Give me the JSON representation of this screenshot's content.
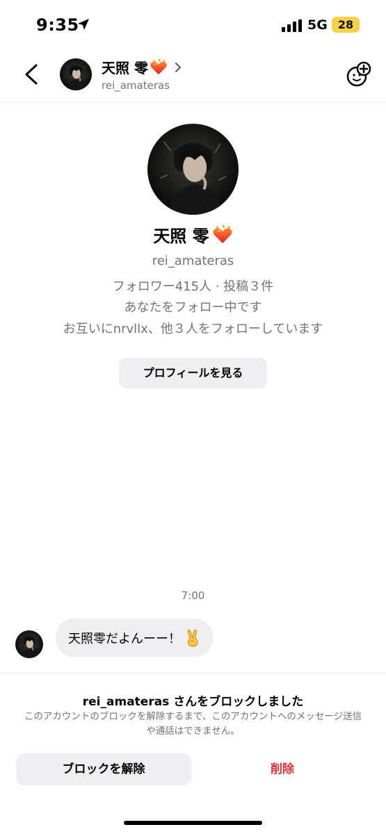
{
  "status_bar": {
    "time": "9:35",
    "network": "5G",
    "battery": "28",
    "battery_color": "#f6d24a"
  },
  "header": {
    "name": "天照 零",
    "username": "rei_amateras",
    "heart_icon": "heart-on-fire-icon",
    "effects_icon": "face-plus-icon"
  },
  "profile": {
    "name": "天照 零",
    "username": "rei_amateras",
    "stats": "フォロワー415人 · 投稿３件",
    "follow_status": "あなたをフォロー中です",
    "mutual": "お互いにnrvllx、他３人をフォローしています",
    "view_profile_label": "プロフィールを見る"
  },
  "messages": {
    "timestamp": "7:00",
    "items": [
      {
        "text": "天照零だよんーー！",
        "emoji_icon": "victory-hand-icon"
      }
    ]
  },
  "block_notice": {
    "title": "rei_amateras さんをブロックしました",
    "description": "このアカウントのブロックを解除するまで、このアカウントへのメッセージ送信や通話はできません。",
    "unblock_label": "ブロックを解除",
    "delete_label": "削除",
    "delete_color": "#ed2d3a"
  }
}
